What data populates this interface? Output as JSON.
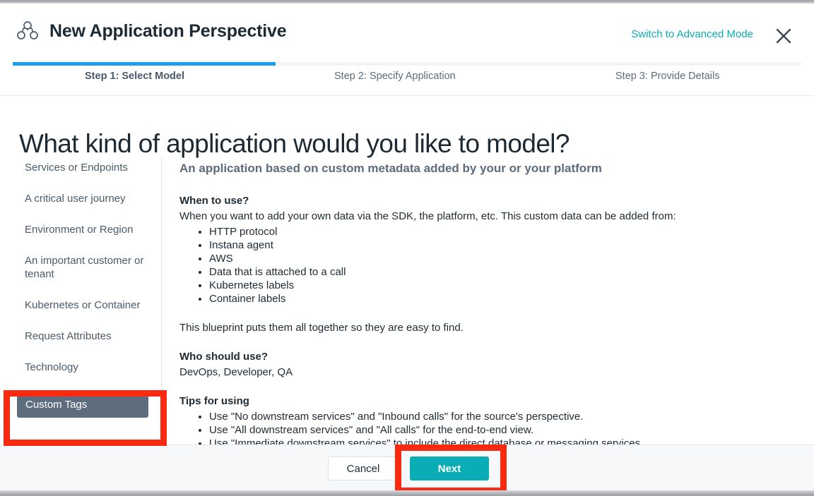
{
  "header": {
    "icon": "topology-group-icon",
    "title": "New Application Perspective",
    "advanced_mode_link": "Switch to Advanced Mode",
    "close_icon": "close-icon",
    "accent_teal": "#0aadb5"
  },
  "progress": {
    "percent": 33,
    "fill_color": "#1b9df0",
    "track_color": "#f2f4f6",
    "steps": [
      {
        "label": "Step 1: Select Model",
        "active": true
      },
      {
        "label": "Step 2: Specify Application",
        "active": false
      },
      {
        "label": "Step 3: Provide Details",
        "active": false
      }
    ]
  },
  "page": {
    "heading": "What kind of application would you like to model?"
  },
  "menu": {
    "items": [
      {
        "label": "Services or Endpoints",
        "selected": false
      },
      {
        "label": "A critical user journey",
        "selected": false
      },
      {
        "label": "Environment or Region",
        "selected": false
      },
      {
        "label": "An important customer or tenant",
        "selected": false
      },
      {
        "label": "Kubernetes or Container",
        "selected": false
      },
      {
        "label": "Request Attributes",
        "selected": false
      },
      {
        "label": "Technology",
        "selected": false
      },
      {
        "label": "Custom Tags",
        "selected": true
      }
    ],
    "selected_bg": "#5d6d7e"
  },
  "detail": {
    "lead": "An application based on custom metadata added by your or your platform",
    "when_to_use": {
      "title": "When to use?",
      "intro": "When you want to add your own data via the SDK, the platform, etc. This custom data can be added from:",
      "bullets": [
        "HTTP protocol",
        "Instana agent",
        "AWS",
        "Data that is attached to a call",
        "Kubernetes labels",
        "Container labels"
      ],
      "outro": "This blueprint puts them all together so they are easy to find."
    },
    "who_should_use": {
      "title": "Who should use?",
      "text": "DevOps, Developer, QA"
    },
    "tips": {
      "title": "Tips for using",
      "bullets": [
        "Use \"No downstream services\" and \"Inbound calls\" for the source's perspective.",
        "Use \"All downstream services\" and \"All calls\" for the end-to-end view.",
        "Use \"Immediate downstream services\" to include the direct database or messaging services."
      ]
    }
  },
  "footer": {
    "cancel_label": "Cancel",
    "next_label": "Next",
    "next_color": "#0aadb5"
  },
  "annotations": {
    "color": "#fa2a10",
    "boxes": [
      {
        "target": "custom-tags-menu-item"
      },
      {
        "target": "next-button"
      }
    ]
  }
}
